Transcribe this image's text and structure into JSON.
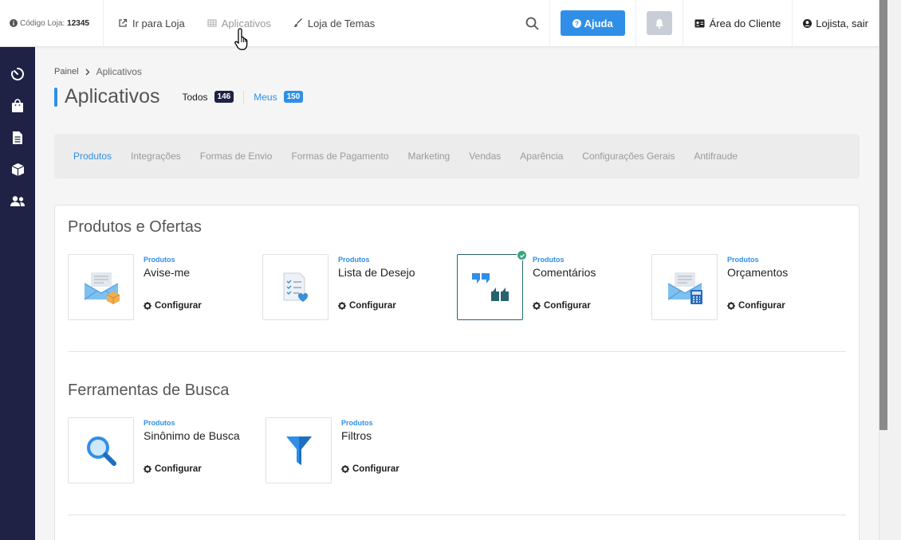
{
  "topbar": {
    "store_code_label": "Código Loja:",
    "store_code_value": "12345",
    "nav": {
      "go_to_store": "Ir para Loja",
      "apps": "Aplicativos",
      "theme_store": "Loja de Temas"
    },
    "help_label": "Ajuda",
    "client_area": "Área do Cliente",
    "logout": "Lojista, sair"
  },
  "breadcrumb": {
    "root": "Painel",
    "current": "Aplicativos"
  },
  "page": {
    "title": "Aplicativos",
    "all_label": "Todos",
    "all_count": "146",
    "mine_label": "Meus",
    "mine_count": "150"
  },
  "tabs": [
    "Produtos",
    "Integrações",
    "Formas de Envio",
    "Formas de Pagamento",
    "Marketing",
    "Vendas",
    "Aparência",
    "Configurações Gerais",
    "Antifraude"
  ],
  "sections": [
    {
      "title": "Produtos e Ofertas",
      "apps": [
        {
          "category": "Produtos",
          "name": "Avise-me",
          "action": "Configurar",
          "icon": "envelope-box-icon"
        },
        {
          "category": "Produtos",
          "name": "Lista de Desejo",
          "action": "Configurar",
          "icon": "wishlist-icon"
        },
        {
          "category": "Produtos",
          "name": "Comentários",
          "action": "Configurar",
          "icon": "comments-icon",
          "selected": true
        },
        {
          "category": "Produtos",
          "name": "Orçamentos",
          "action": "Configurar",
          "icon": "envelope-calculator-icon"
        }
      ]
    },
    {
      "title": "Ferramentas de Busca",
      "apps": [
        {
          "category": "Produtos",
          "name": "Sinônimo de Busca",
          "action": "Configurar",
          "icon": "magnifier-icon"
        },
        {
          "category": "Produtos",
          "name": "Filtros",
          "action": "Configurar",
          "icon": "funnel-icon"
        }
      ]
    }
  ],
  "colors": {
    "accent": "#2f8fe8",
    "sidebar": "#1f2244",
    "selected_border": "#27646e",
    "check": "#3aa57a"
  }
}
